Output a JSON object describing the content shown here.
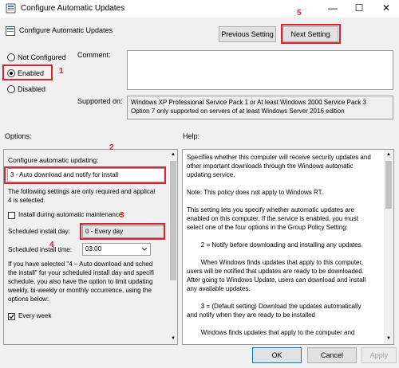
{
  "window": {
    "title": "Configure Automatic Updates",
    "minimize": "—",
    "maximize": "☐",
    "close": "✕"
  },
  "header": {
    "policy_name": "Configure Automatic Updates",
    "prev_label": "Previous Setting",
    "next_label": "Next Setting"
  },
  "state": {
    "not_configured": "Not Configured",
    "enabled": "Enabled",
    "disabled": "Disabled",
    "selected": "enabled"
  },
  "comment": {
    "label": "Comment:",
    "value": ""
  },
  "supported": {
    "label": "Supported on:",
    "lines": [
      "Windows XP Professional Service Pack 1 or At least Windows 2000 Service Pack 3",
      "Option 7 only supported on servers of at least Windows Server 2016 edition"
    ]
  },
  "options": {
    "label": "Options:",
    "configure_label": "Configure automatic updating:",
    "dropdown_value": "3 - Auto download and notify for install",
    "note_lines": [
      "The following settings are only required and applical",
      "4 is selected."
    ],
    "maintenance_label": "Install during automatic maintenance",
    "install_day_label": "Scheduled install day:",
    "install_day_value": "0 - Every day",
    "install_time_label": "Scheduled install time:",
    "install_time_value": "03:00",
    "text_lines": [
      "If you have selected \"4 – Auto download and sched",
      "the install\" for your scheduled install day and specifi",
      "schedule, you also have the option to limit updating",
      "weekly, bi-weekly or monthly occurrence, using the",
      "options below:"
    ],
    "every_week_label": "Every week",
    "every_week_checked": true
  },
  "help": {
    "label": "Help:",
    "paragraphs": [
      [
        "Specifies whether this computer will receive security updates and",
        "other important downloads through the Windows automatic",
        "updating service."
      ],
      [
        "Note: This policy does not apply to Windows RT."
      ],
      [
        "This setting lets you specify whether automatic updates are",
        "enabled on this computer. If the service is enabled, you must",
        "select one of the four options in the Group Policy Setting:"
      ],
      [
        "        2 = Notify before downloading and installing any updates."
      ],
      [
        "        When Windows finds updates that apply to this computer,",
        "users will be notified that updates are ready to be downloaded.",
        "After going to Windows Update, users can download and install",
        "any available updates."
      ],
      [
        "        3 = (Default setting) Download the updates automatically",
        "and notify when they are ready to be installed"
      ],
      [
        "        Windows finds updates that apply to the computer and"
      ]
    ]
  },
  "footer": {
    "ok": "OK",
    "cancel": "Cancel",
    "apply": "Apply"
  },
  "annotations": {
    "n1": "1",
    "n2": "2",
    "n3": "3",
    "n4": "4",
    "n5": "5"
  },
  "colors": {
    "annotation": "#e0202f",
    "window_bg": "#f0f0f0",
    "ok_border": "#0078d7"
  }
}
